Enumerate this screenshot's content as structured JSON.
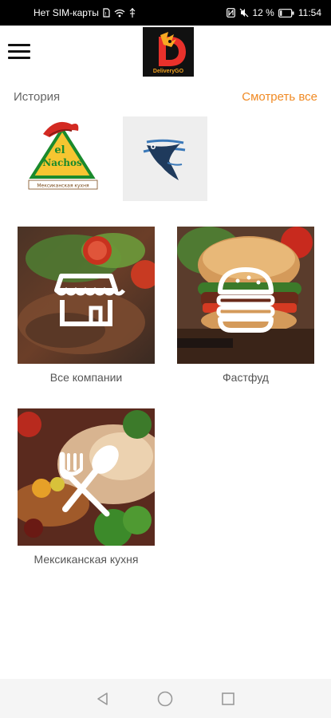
{
  "status_bar": {
    "carrier": "Нет SIM-карты",
    "battery": "12 %",
    "time": "11:54"
  },
  "app_bar": {
    "logo_text": "DeliveryGO",
    "menu_icon": "hamburger-menu-icon"
  },
  "history": {
    "title": "История",
    "see_all": "Смотреть все",
    "items": [
      {
        "name": "El Nachos",
        "logo_word_1": "el",
        "logo_word_2": "Nachos",
        "logo_tagline": "Мексиканская кухня"
      },
      {
        "name": "fish-restaurant-logo"
      }
    ]
  },
  "categories": [
    {
      "label": "Все компании",
      "icon": "store-icon"
    },
    {
      "label": "Фастфуд",
      "icon": "burger-icon"
    },
    {
      "label": "Мексиканская кухня",
      "icon": "fork-spoon-icon"
    }
  ],
  "colors": {
    "accent": "#f08a24",
    "text_secondary": "#666666",
    "status_bar_bg": "#000000"
  }
}
